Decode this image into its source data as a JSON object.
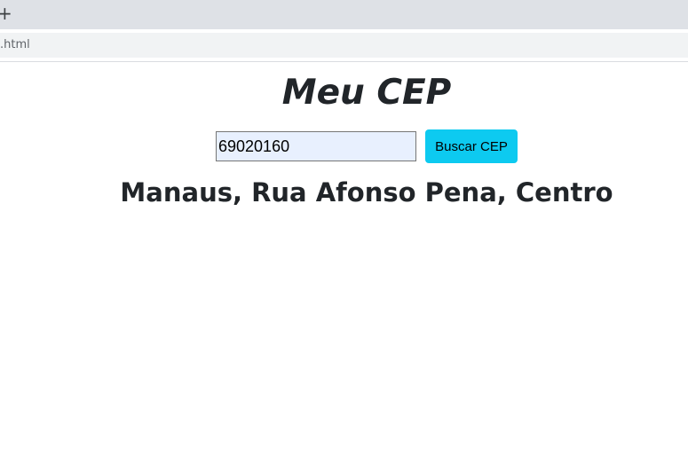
{
  "browser": {
    "new_tab_glyph": "+",
    "url_fragment": ".html"
  },
  "page": {
    "title": "Meu CEP",
    "cep_input_value": "69020160",
    "search_button_label": "Buscar CEP",
    "result_text": "Manaus, Rua Afonso Pena, Centro"
  },
  "colors": {
    "button_accent": "#0dcaf0",
    "input_autofill_bg": "#e8f0fe",
    "text": "#212529"
  }
}
